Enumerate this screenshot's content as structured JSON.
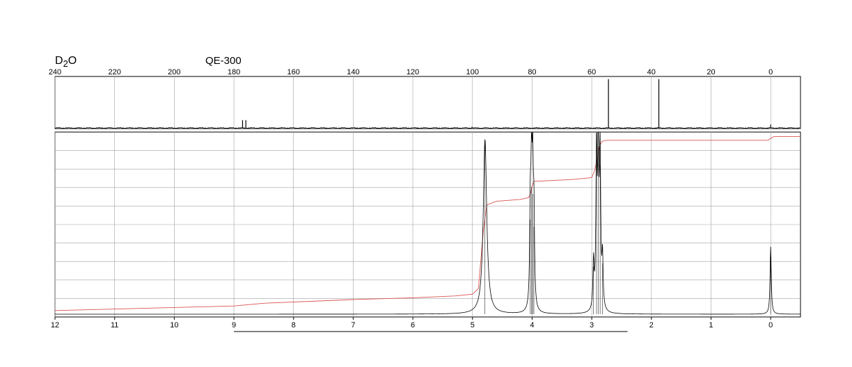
{
  "header": {
    "solvent_main": "D",
    "solvent_sub": "2",
    "solvent_tail": "O",
    "instrument": "QE-300"
  },
  "colors": {
    "trace": "#000000",
    "integral": "#d9534f",
    "grid": "#a0a0a0"
  },
  "chart_data": [
    {
      "type": "line",
      "title": "",
      "xlabel": "",
      "ylabel": "",
      "x_reversed": true,
      "xlim": [
        240,
        -10
      ],
      "ticks": [
        "240",
        "220",
        "200",
        "180",
        "160",
        "140",
        "120",
        "100",
        "80",
        "60",
        "40",
        "20",
        "0"
      ],
      "tick_values": [
        240,
        220,
        200,
        180,
        160,
        140,
        120,
        100,
        80,
        60,
        40,
        20,
        0
      ],
      "grid": true,
      "peaks": [
        {
          "x": 177.1,
          "h": 0.16
        },
        {
          "x": 176.0,
          "h": 0.16
        },
        {
          "x": 100.2,
          "h": 0.02
        },
        {
          "x": 54.4,
          "h": 1.0
        },
        {
          "x": 37.5,
          "h": 1.0
        },
        {
          "x": 0.0,
          "h": 0.07
        }
      ]
    },
    {
      "type": "line",
      "title": "",
      "xlabel": "",
      "ylabel": "",
      "x_reversed": true,
      "xlim": [
        12,
        -0.5
      ],
      "ticks": [
        "12",
        "11",
        "10",
        "9",
        "8",
        "7",
        "6",
        "5",
        "4",
        "3",
        "2",
        "1",
        "0"
      ],
      "tick_values": [
        12,
        11,
        10,
        9,
        8,
        7,
        6,
        5,
        4,
        3,
        2,
        1,
        0
      ],
      "grid": true,
      "peaks": [
        {
          "x": 4.79,
          "h": 0.96
        },
        {
          "x": 4.03,
          "h": 0.52
        },
        {
          "x": 4.01,
          "h": 0.7
        },
        {
          "x": 3.99,
          "h": 0.66
        },
        {
          "x": 3.97,
          "h": 0.48
        },
        {
          "x": 2.97,
          "h": 0.26
        },
        {
          "x": 2.92,
          "h": 0.85
        },
        {
          "x": 2.89,
          "h": 0.92
        },
        {
          "x": 2.86,
          "h": 0.82
        },
        {
          "x": 2.82,
          "h": 0.28
        },
        {
          "x": 0.0,
          "h": 0.37
        }
      ],
      "integral": {
        "x": [
          12,
          9,
          8.5,
          7,
          6,
          5.3,
          5.0,
          4.9,
          4.82,
          4.76,
          4.6,
          4.2,
          4.06,
          4.03,
          4.0,
          3.97,
          3.9,
          3.3,
          3.0,
          2.95,
          2.9,
          2.86,
          2.82,
          2.75,
          2.5,
          1.0,
          0.05,
          0.0,
          -0.05,
          -0.5
        ],
        "y": [
          0.02,
          0.045,
          0.06,
          0.08,
          0.09,
          0.1,
          0.11,
          0.14,
          0.45,
          0.6,
          0.62,
          0.63,
          0.64,
          0.66,
          0.7,
          0.73,
          0.73,
          0.74,
          0.75,
          0.79,
          0.87,
          0.93,
          0.95,
          0.955,
          0.955,
          0.955,
          0.955,
          0.965,
          0.975,
          0.975
        ]
      },
      "integration_bar": {
        "from": 9.0,
        "to": 2.4
      }
    }
  ]
}
